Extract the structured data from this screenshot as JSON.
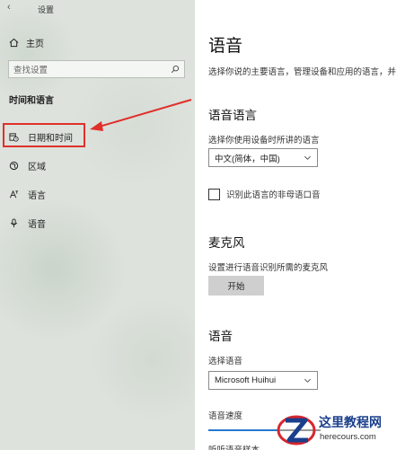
{
  "window": {
    "title": "设置"
  },
  "sidebar": {
    "home_label": "主页",
    "search_placeholder": "查找设置",
    "section_title": "时间和语言",
    "items": [
      {
        "label": "日期和时间",
        "icon": "calendar-clock-icon",
        "highlighted": true
      },
      {
        "label": "区域",
        "icon": "globe-region-icon"
      },
      {
        "label": "语言",
        "icon": "language-icon"
      },
      {
        "label": "语音",
        "icon": "microphone-icon"
      }
    ]
  },
  "main": {
    "title": "语音",
    "description": "选择你说的主要语言，管理设备和应用的语言，并",
    "speech_language": {
      "heading": "语音语言",
      "label": "选择你使用设备时所讲的语言",
      "selected": "中文(简体，中国)",
      "checkbox_label": "识别此语言的非母语口音"
    },
    "microphone": {
      "heading": "麦克风",
      "label": "设置进行语音识别所需的麦克风",
      "button_label": "开始"
    },
    "voice": {
      "heading": "语音",
      "label": "选择语音",
      "selected": "Microsoft Huihui",
      "speed_label": "语音速度",
      "speed_level": 0.62,
      "preview_label": "听听语音样本"
    }
  },
  "watermark": {
    "text": "这里教程网",
    "url": "herecours.com",
    "color": "#1b3f8c"
  },
  "colors": {
    "annotation": "#e0302c",
    "accent": "#2678cf"
  }
}
